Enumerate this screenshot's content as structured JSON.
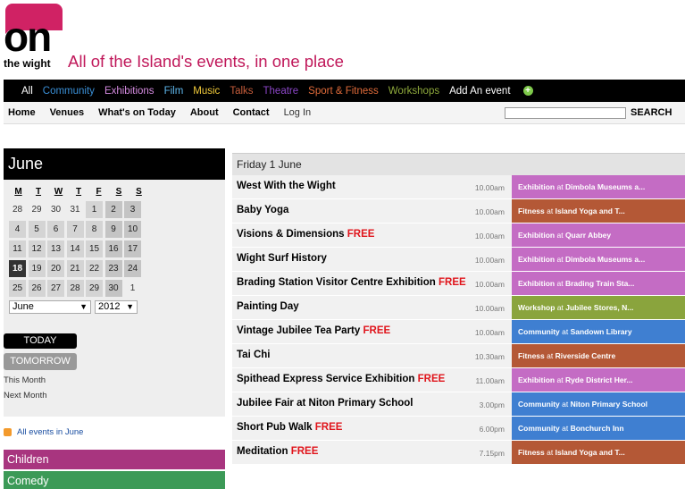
{
  "header": {
    "logo_text": "on",
    "logo_sub": "the wight",
    "tagline": "All of the Island's events, in one place"
  },
  "catbar": {
    "items": [
      {
        "label": "All",
        "color": "#ffffff"
      },
      {
        "label": "Community",
        "color": "#3a8fd6"
      },
      {
        "label": "Exhibitions",
        "color": "#d58be0"
      },
      {
        "label": "Film",
        "color": "#5fb9ee"
      },
      {
        "label": "Music",
        "color": "#f0c93a"
      },
      {
        "label": "Talks",
        "color": "#c65d3b"
      },
      {
        "label": "Theatre",
        "color": "#8b46c7"
      },
      {
        "label": "Sport & Fitness",
        "color": "#e06b3a"
      },
      {
        "label": "Workshops",
        "color": "#8faa3c"
      },
      {
        "label": "Add An event",
        "color": "#ffffff"
      }
    ],
    "add_icon": "plus-circle-icon"
  },
  "nav": {
    "items": [
      "Home",
      "Venues",
      "What's on Today",
      "About",
      "Contact"
    ],
    "login": "Log In",
    "search_placeholder": "",
    "search_label": "SEARCH"
  },
  "sidebar": {
    "month_title": "June",
    "dow": [
      "M",
      "T",
      "W",
      "T",
      "F",
      "S",
      "S"
    ],
    "weeks": [
      [
        "28",
        "29",
        "30",
        "31",
        "1",
        "2",
        "3"
      ],
      [
        "4",
        "5",
        "6",
        "7",
        "8",
        "9",
        "10"
      ],
      [
        "11",
        "12",
        "13",
        "14",
        "15",
        "16",
        "17"
      ],
      [
        "18",
        "19",
        "20",
        "21",
        "22",
        "23",
        "24"
      ],
      [
        "25",
        "26",
        "27",
        "28",
        "29",
        "30",
        "1"
      ]
    ],
    "selected_day": "18",
    "month_select": "June",
    "year_select": "2012",
    "today_label": "TODAY",
    "tomorrow_label": "TOMORROW",
    "this_month": "This Month",
    "next_month": "Next Month",
    "rss_label": "All events in June",
    "genres": [
      {
        "label": "Children",
        "color": "#a8357f"
      },
      {
        "label": "Comedy",
        "color": "#3c9a57"
      }
    ]
  },
  "events": {
    "day_heading": "Friday 1 June",
    "category_colors": {
      "Exhibition": "#c46cc4",
      "Fitness": "#b45836",
      "Workshop": "#8aa43d",
      "Community": "#3f7fd1"
    },
    "items": [
      {
        "title": "West With the Wight",
        "free": "",
        "time": "10.00am",
        "category": "Exhibition",
        "venue": "Dimbola Museums a..."
      },
      {
        "title": "Baby Yoga",
        "free": "",
        "time": "10.00am",
        "category": "Fitness",
        "venue": "Island Yoga and T..."
      },
      {
        "title": "Visions & Dimensions",
        "free": "FREE",
        "time": "10.00am",
        "category": "Exhibition",
        "venue": "Quarr Abbey"
      },
      {
        "title": "Wight Surf History",
        "free": "",
        "time": "10.00am",
        "category": "Exhibition",
        "venue": "Dimbola Museums a..."
      },
      {
        "title": "Brading Station Visitor Centre Exhibition",
        "free": "FREE",
        "time": "10.00am",
        "category": "Exhibition",
        "venue": "Brading Train Sta..."
      },
      {
        "title": "Painting Day",
        "free": "",
        "time": "10.00am",
        "category": "Workshop",
        "venue": "Jubilee Stores, N..."
      },
      {
        "title": "Vintage Jubilee Tea Party",
        "free": "FREE",
        "time": "10.00am",
        "category": "Community",
        "venue": "Sandown Library"
      },
      {
        "title": "Tai Chi",
        "free": "",
        "time": "10.30am",
        "category": "Fitness",
        "venue": "Riverside Centre"
      },
      {
        "title": "Spithead Express Service Exhibition",
        "free": "FREE",
        "time": "11.00am",
        "category": "Exhibition",
        "venue": "Ryde District Her..."
      },
      {
        "title": "Jubilee Fair at Niton Primary School",
        "free": "",
        "time": "3.00pm",
        "category": "Community",
        "venue": "Niton Primary School"
      },
      {
        "title": "Short Pub Walk",
        "free": "FREE",
        "time": "6.00pm",
        "category": "Community",
        "venue": "Bonchurch Inn"
      },
      {
        "title": "Meditation",
        "free": "FREE",
        "time": "7.15pm",
        "category": "Fitness",
        "venue": "Island Yoga and T..."
      }
    ],
    "at_word": "at"
  }
}
